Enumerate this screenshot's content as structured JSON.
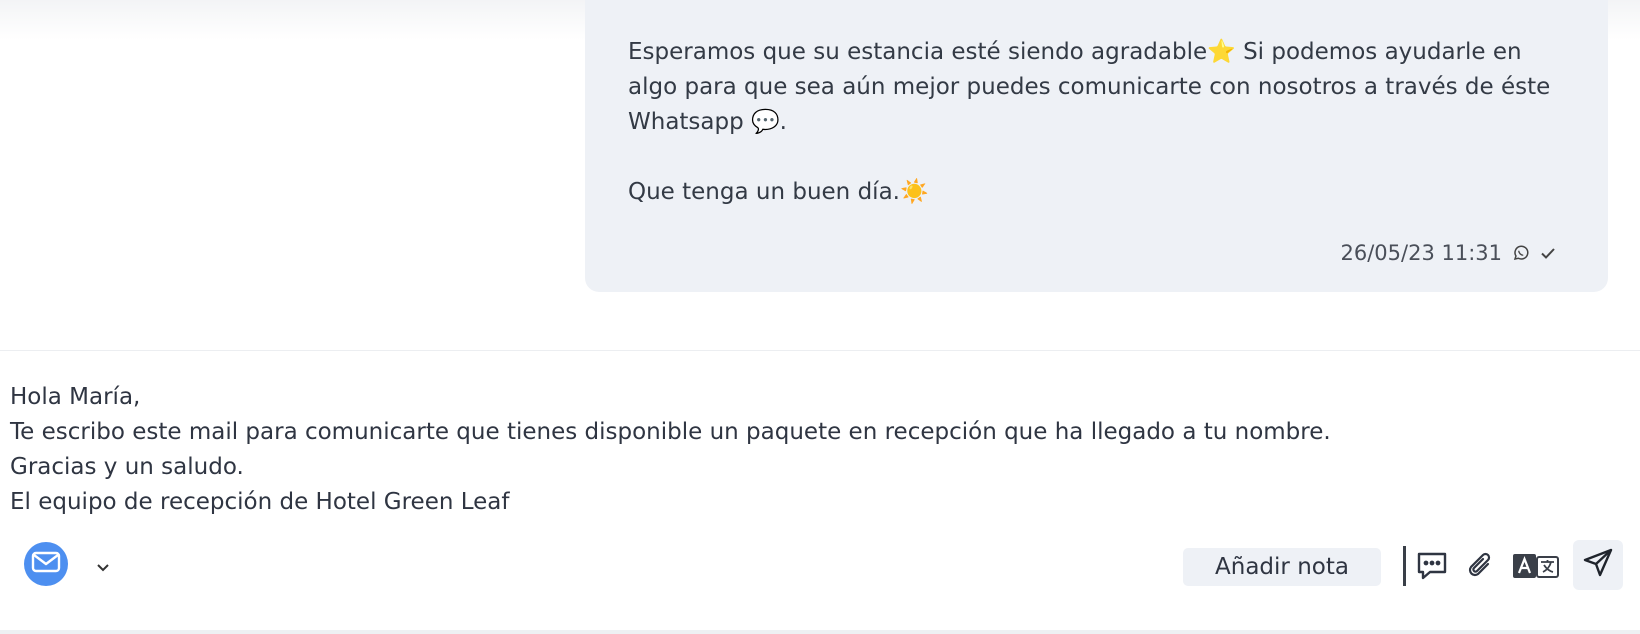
{
  "message": {
    "lines": [
      "Esperamos que su estancia esté siendo agradable⭐ Si podemos ayudarle en algo para que sea aún mejor puedes comunicarte con nosotros a través de éste Whatsapp 💬.",
      "Que tenga un buen día.☀️"
    ],
    "timestamp": "26/05/23 11:31",
    "channel_icon": "whatsapp-icon",
    "status_icon": "check-icon"
  },
  "draft": {
    "lines": [
      "Hola María,",
      "Te escribo este mail para comunicarte que tienes disponible un paquete en recepción que ha llegado a tu nombre.",
      "Gracias y un saludo.",
      "El equipo de recepción de Hotel Green Leaf"
    ]
  },
  "composer": {
    "channel_icon": "mail-icon",
    "add_note_label": "Añadir nota",
    "tools": [
      "quick-reply-icon",
      "attachment-icon",
      "translate-icon",
      "send-icon"
    ],
    "accent_color": "#4d8ff0"
  }
}
